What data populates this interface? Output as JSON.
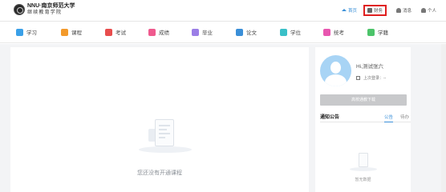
{
  "header": {
    "logo_top": "NNU·南京师范大学",
    "logo_bottom": "继续教育学院",
    "nav": [
      {
        "label": "首页",
        "icon": "home-icon",
        "active": true
      },
      {
        "label": "财务",
        "icon": "finance-icon",
        "highlight": true
      },
      {
        "label": "消息",
        "icon": "bell-icon"
      },
      {
        "label": "个人",
        "icon": "user-icon"
      }
    ]
  },
  "navbar": {
    "items": [
      {
        "label": "学习",
        "icon": "study-icon",
        "color": "#3aa0e8"
      },
      {
        "label": "课程",
        "icon": "course-icon",
        "color": "#f39a2b"
      },
      {
        "label": "考试",
        "icon": "exam-icon",
        "color": "#e84d4d"
      },
      {
        "label": "成绩",
        "icon": "score-icon",
        "color": "#ef5a8e"
      },
      {
        "label": "毕业",
        "icon": "graduation-icon",
        "color": "#9b7ee6"
      },
      {
        "label": "论文",
        "icon": "thesis-icon",
        "color": "#3a8fd8"
      },
      {
        "label": "学位",
        "icon": "degree-icon",
        "color": "#3ac0c8"
      },
      {
        "label": "统考",
        "icon": "unified-exam-icon",
        "color": "#e857b0"
      },
      {
        "label": "学籍",
        "icon": "student-status-icon",
        "color": "#4cc46a"
      }
    ]
  },
  "main": {
    "empty_text": "您还没有开通课程"
  },
  "side": {
    "greeting": "Hi,测试张六",
    "last_login_label": "上次登录：",
    "last_login_value": "--",
    "download_button": "高校通教下载",
    "notice_title": "通知公告",
    "notice_tabs": [
      {
        "label": "公告",
        "active": true
      },
      {
        "label": "待办",
        "active": false
      }
    ],
    "no_data_text": "暂无数据"
  }
}
